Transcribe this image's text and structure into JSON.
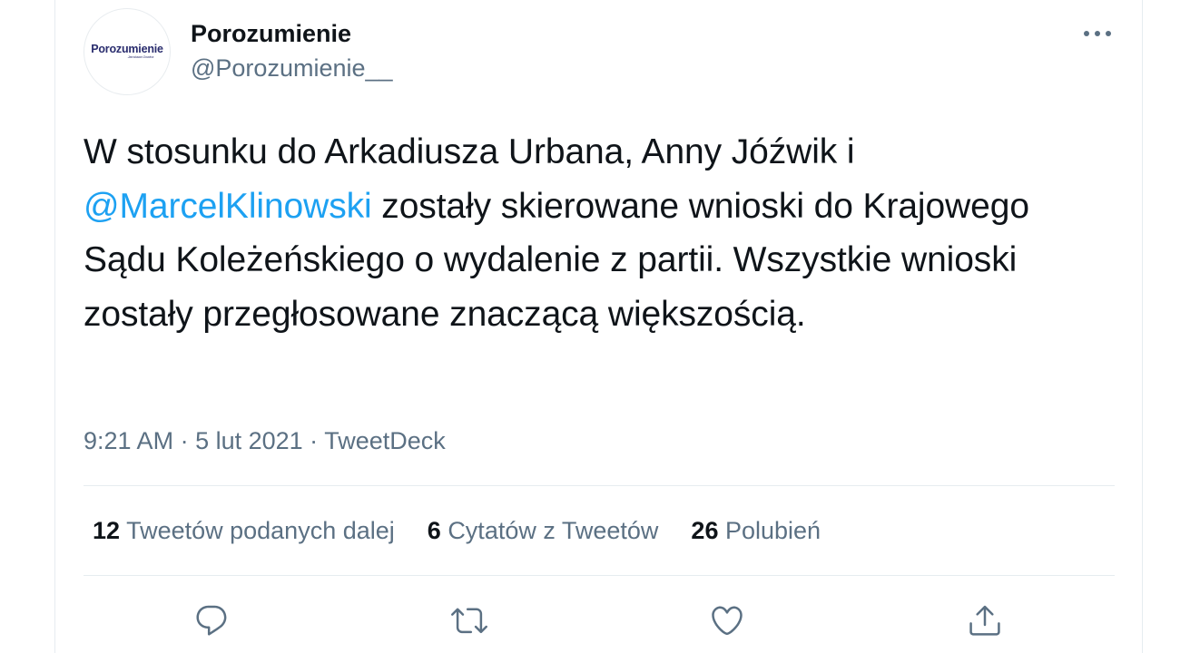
{
  "profile": {
    "avatar_logo_text": "Porozumienie",
    "avatar_sub_text": "Jarosława Gowina",
    "display_name": "Porozumienie",
    "handle": "@Porozumienie__"
  },
  "tweet": {
    "text_part1": "W stosunku do Arkadiusza Urbana, Anny Jóźwik i ",
    "mention": "@MarcelKlinowski",
    "text_part2": " zostały skierowane wnioski do Krajowego Sądu Koleżeńskiego o wydalenie z partii. Wszystkie wnioski zostały przegłosowane znaczącą większością."
  },
  "meta": {
    "time": "9:21 AM",
    "separator1": " · ",
    "date": "5 lut 2021",
    "separator2": " · ",
    "source": "TweetDeck"
  },
  "stats": {
    "retweets_count": "12",
    "retweets_label": "Tweetów podanych dalej",
    "quotes_count": "6",
    "quotes_label": "Cytatów z Tweetów",
    "likes_count": "26",
    "likes_label": "Polubień"
  },
  "icons": {
    "more": "more-horizontal-icon",
    "reply": "reply-icon",
    "retweet": "retweet-icon",
    "like": "heart-icon",
    "share": "share-icon"
  },
  "colors": {
    "text_primary": "#0f1419",
    "text_secondary": "#5b7083",
    "link": "#1da1f2",
    "border": "#e6ecf0",
    "brand_logo": "#2a2d6e"
  }
}
